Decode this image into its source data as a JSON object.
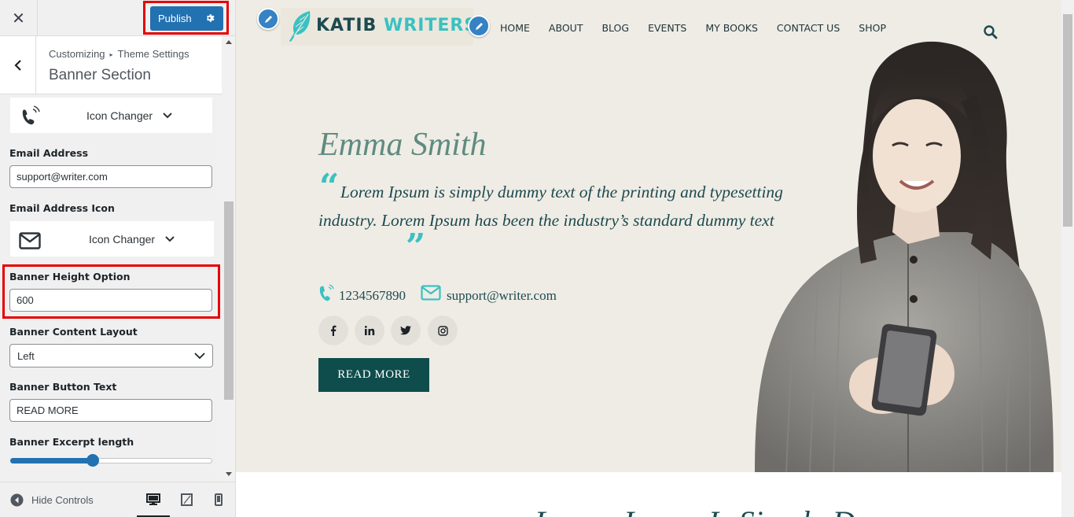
{
  "customizer": {
    "close_glyph": "✕",
    "publish_label": "Publish",
    "breadcrumb": {
      "parent": "Customizing",
      "separator": "▸",
      "current": "Theme Settings"
    },
    "section_title": "Banner Section",
    "phone_icon_changer": {
      "icon": "phone-icon",
      "label": "Icon Changer"
    },
    "email_address": {
      "label": "Email Address",
      "value": "support@writer.com"
    },
    "email_icon": {
      "label": "Email Address Icon",
      "icon": "envelope-icon",
      "changer_label": "Icon Changer"
    },
    "banner_height": {
      "label": "Banner Height Option",
      "value": "600"
    },
    "content_layout": {
      "label": "Banner Content Layout",
      "selected": "Left"
    },
    "button_text": {
      "label": "Banner Button Text",
      "value": "READ MORE"
    },
    "excerpt_length": {
      "label": "Banner Excerpt length",
      "slider_fraction": 0.41
    },
    "footer": {
      "hide_controls": "Hide Controls",
      "devices": [
        "desktop-icon",
        "tablet-icon",
        "mobile-icon"
      ],
      "active_device": "desktop-icon"
    },
    "highlight_color": "#e60000",
    "accent_color": "#2271b1"
  },
  "site": {
    "logo": {
      "part1": "KATIB",
      "part2": "WRITERS"
    },
    "nav": [
      "HOME",
      "ABOUT",
      "BLOG",
      "EVENTS",
      "MY BOOKS",
      "CONTACT US",
      "SHOP"
    ],
    "hero": {
      "name": "Emma Smith",
      "quote_open": "“",
      "quote": "Lorem Ipsum is simply dummy text of the printing and typesetting industry. Lorem Ipsum has been the industry’s standard dummy text",
      "quote_close": "”",
      "phone": "1234567890",
      "email": "support@writer.com",
      "social": [
        "facebook-icon",
        "linkedin-icon",
        "twitter-icon",
        "instagram-icon"
      ],
      "button": "READ MORE"
    },
    "next_heading": "Lorem Ipsum Is Simply Dummy",
    "colors": {
      "teal_dark": "#0f4d4c",
      "teal_light": "#3ac1c1",
      "hero_bg": "#efece5"
    }
  }
}
